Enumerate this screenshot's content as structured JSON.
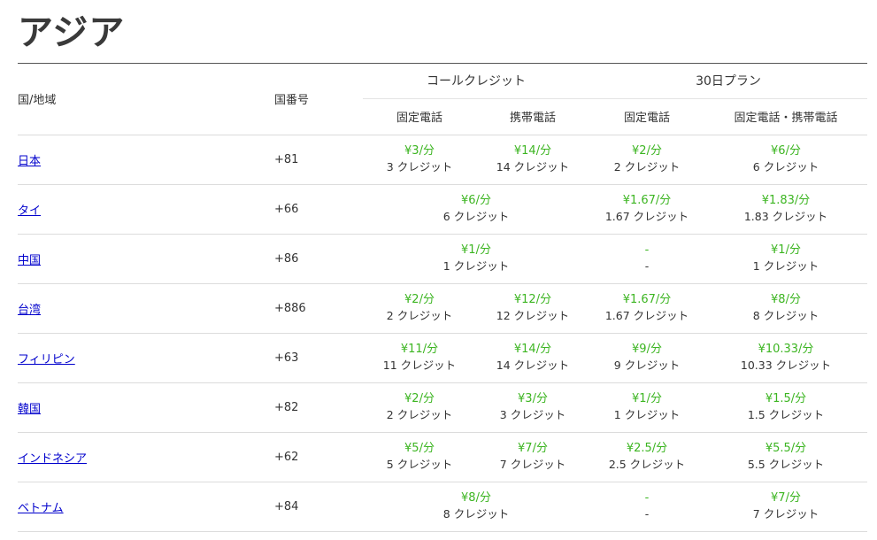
{
  "heading": "アジア",
  "table": {
    "col_country": "国/地域",
    "col_code": "国番号",
    "group_call_credit": "コールクレジット",
    "group_30day_plan": "30日プラン",
    "sub_landline": "固定電話",
    "sub_mobile": "携帯電話",
    "sub_plan_landline": "固定電話",
    "sub_plan_both": "固定電話・携帯電話",
    "rows": [
      {
        "country": "日本",
        "code": "+81",
        "land_price": "¥3/分",
        "land_credit": "3 クレジット",
        "mobile_price": "¥14/分",
        "mobile_credit": "14 クレジット",
        "plan_land_price": "¥2/分",
        "plan_land_credit": "2 クレジット",
        "plan_both_price": "¥6/分",
        "plan_both_credit": "6 クレジット"
      },
      {
        "country": "タイ",
        "code": "+66",
        "merged_price": "¥6/分",
        "merged_credit": "6 クレジット",
        "plan_land_price": "¥1.67/分",
        "plan_land_credit": "1.67 クレジット",
        "plan_both_price": "¥1.83/分",
        "plan_both_credit": "1.83 クレジット"
      },
      {
        "country": "中国",
        "code": "+86",
        "merged_price": "¥1/分",
        "merged_credit": "1 クレジット",
        "plan_land_price": "-",
        "plan_land_credit": "-",
        "plan_both_price": "¥1/分",
        "plan_both_credit": "1 クレジット"
      },
      {
        "country": "台湾",
        "code": "+886",
        "land_price": "¥2/分",
        "land_credit": "2 クレジット",
        "mobile_price": "¥12/分",
        "mobile_credit": "12 クレジット",
        "plan_land_price": "¥1.67/分",
        "plan_land_credit": "1.67 クレジット",
        "plan_both_price": "¥8/分",
        "plan_both_credit": "8 クレジット"
      },
      {
        "country": "フィリピン",
        "code": "+63",
        "land_price": "¥11/分",
        "land_credit": "11 クレジット",
        "mobile_price": "¥14/分",
        "mobile_credit": "14 クレジット",
        "plan_land_price": "¥9/分",
        "plan_land_credit": "9 クレジット",
        "plan_both_price": "¥10.33/分",
        "plan_both_credit": "10.33 クレジット"
      },
      {
        "country": "韓国",
        "code": "+82",
        "land_price": "¥2/分",
        "land_credit": "2 クレジット",
        "mobile_price": "¥3/分",
        "mobile_credit": "3 クレジット",
        "plan_land_price": "¥1/分",
        "plan_land_credit": "1 クレジット",
        "plan_both_price": "¥1.5/分",
        "plan_both_credit": "1.5 クレジット"
      },
      {
        "country": "インドネシア",
        "code": "+62",
        "land_price": "¥5/分",
        "land_credit": "5 クレジット",
        "mobile_price": "¥7/分",
        "mobile_credit": "7 クレジット",
        "plan_land_price": "¥2.5/分",
        "plan_land_credit": "2.5 クレジット",
        "plan_both_price": "¥5.5/分",
        "plan_both_credit": "5.5 クレジット"
      },
      {
        "country": "ベトナム",
        "code": "+84",
        "merged_price": "¥8/分",
        "merged_credit": "8 クレジット",
        "plan_land_price": "-",
        "plan_land_credit": "-",
        "plan_both_price": "¥7/分",
        "plan_both_credit": "7 クレジット"
      }
    ]
  },
  "colors": {
    "price_green": "#3cb521",
    "link_blue": "#0000cc",
    "text": "#333333",
    "rule": "#dcdcdc"
  }
}
